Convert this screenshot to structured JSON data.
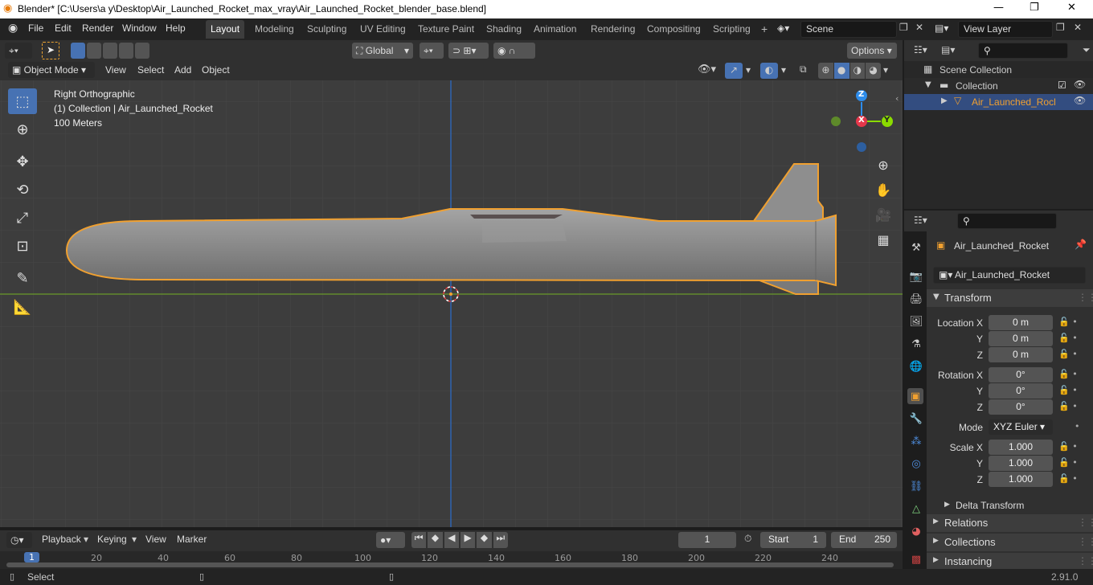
{
  "title": "Blender* [C:\\Users\\a y\\Desktop\\Air_Launched_Rocket_max_vray\\Air_Launched_Rocket_blender_base.blend]",
  "window_controls": {
    "minimize": "—",
    "maximize": "❐",
    "close": "✕"
  },
  "menus": [
    "File",
    "Edit",
    "Render",
    "Window",
    "Help"
  ],
  "workspaces": [
    "Layout",
    "Modeling",
    "Sculpting",
    "UV Editing",
    "Texture Paint",
    "Shading",
    "Animation",
    "Rendering",
    "Compositing",
    "Scripting"
  ],
  "workspace_add": "+",
  "scene": "Scene",
  "view_layer": "View Layer",
  "viewport_header": {
    "transform_orientation": "Global",
    "options": "Options",
    "mode": "Object Mode",
    "menus": [
      "View",
      "Select",
      "Add",
      "Object"
    ]
  },
  "viewport": {
    "view_name": "Right Orthographic",
    "collection_info": "(1) Collection | Air_Launched_Rocket",
    "scale": "100 Meters",
    "gizmo": {
      "z": "Z",
      "x": "X",
      "y": "Y"
    }
  },
  "outliner": {
    "scene_collection": "Scene Collection",
    "collection": "Collection",
    "object": "Air_Launched_Rocke"
  },
  "properties": {
    "object_name": "Air_Launched_Rocket",
    "data_name": "Air_Launched_Rocket",
    "transform_label": "Transform",
    "location": {
      "label": "Location X",
      "x": "0 m",
      "y": "0 m",
      "z": "0 m"
    },
    "rotation": {
      "label": "Rotation X",
      "x": "0°",
      "y": "0°",
      "z": "0°"
    },
    "axis_labels": {
      "y": "Y",
      "z": "Z"
    },
    "mode_label": "Mode",
    "mode_value": "XYZ Euler",
    "scale": {
      "label": "Scale X",
      "x": "1.000",
      "y": "1.000",
      "z": "1.000"
    },
    "sections": [
      "Delta Transform",
      "Relations",
      "Collections",
      "Instancing"
    ]
  },
  "timeline": {
    "menus": [
      "Playback",
      "Keying",
      "View",
      "Marker"
    ],
    "current_frame": "1",
    "start_label": "Start",
    "start": "1",
    "end_label": "End",
    "end": "250",
    "ruler": [
      "1",
      "20",
      "40",
      "60",
      "80",
      "100",
      "120",
      "140",
      "160",
      "180",
      "200",
      "220",
      "240"
    ]
  },
  "status": {
    "left": "Select",
    "version": "2.91.0"
  },
  "colors": {
    "accent": "#4772b3",
    "selection_outline": "#f0a030",
    "x_axis": "#e5374b",
    "y_axis": "#8bdc00",
    "z_axis": "#2d8ceb"
  }
}
